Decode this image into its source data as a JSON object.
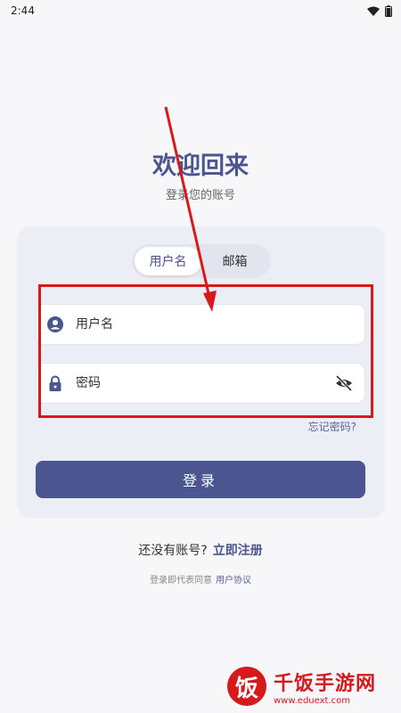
{
  "status_bar": {
    "time": "2:44"
  },
  "header": {
    "title": "欢迎回来",
    "subtitle": "登录您的账号"
  },
  "tabs": [
    {
      "label": "用户名",
      "active": true
    },
    {
      "label": "邮箱",
      "active": false
    }
  ],
  "form": {
    "username_placeholder": "用户名",
    "password_placeholder": "密码",
    "forgot_label": "忘记密码?",
    "login_label": "登录"
  },
  "footer": {
    "no_account": "还没有账号?",
    "register_link": "立即注册",
    "terms_prefix": "登录即代表同意",
    "terms_link": "用户协议"
  },
  "watermark": {
    "logo_char": "饭",
    "name": "千饭手游网",
    "url": "www.eduext.com"
  },
  "colors": {
    "accent": "#4b5590",
    "highlight": "#d7191c"
  }
}
